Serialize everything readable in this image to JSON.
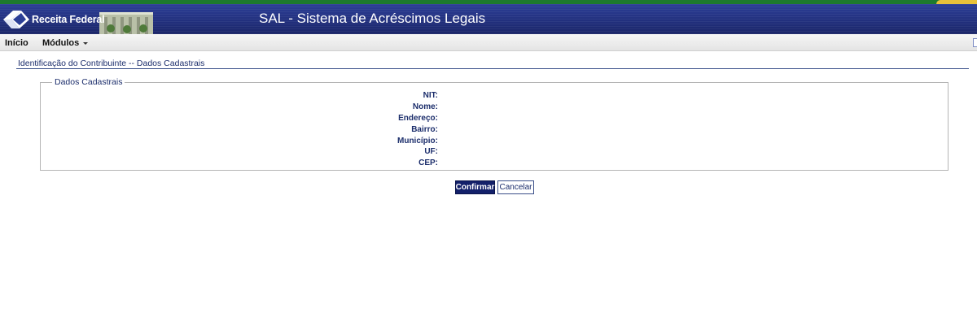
{
  "header": {
    "brand": "Receita Federal",
    "app_title": "SAL - Sistema de Acréscimos Legais"
  },
  "menu": {
    "inicio": "Início",
    "modulos": "Módulos"
  },
  "breadcrumb": "Identificação do Contribuinte -- Dados Cadastrais",
  "form": {
    "legend": "Dados Cadastrais",
    "fields": [
      "NIT:",
      "Nome:",
      "Endereço:",
      "Bairro:",
      "Município:",
      "UF:",
      "CEP:"
    ]
  },
  "buttons": {
    "confirm": "Confirmar",
    "cancel": "Cancelar"
  },
  "colors": {
    "header_blue": "#22307e",
    "top_stripe_green": "#1d7a2e",
    "accent_yellow": "#e8c23a",
    "label_navy": "#1b2d6b",
    "confirm_bg": "#13206a"
  },
  "icons": [
    "receita-federal-logo-icon",
    "building-icon",
    "chevron-down-icon"
  ]
}
